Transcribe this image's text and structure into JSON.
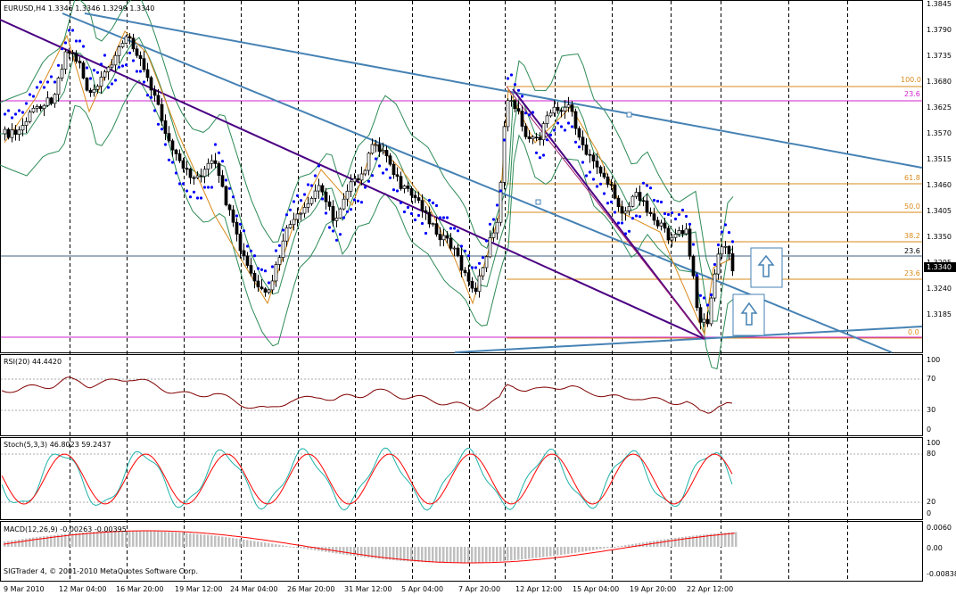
{
  "main_pane": {
    "header": "EURUSD,H4  1.3346 1.3346 1.3299 1.3340",
    "price_labels": [
      "1.3845",
      "1.3790",
      "1.3735",
      "1.3680",
      "1.3625",
      "1.3570",
      "1.3515",
      "1.3460",
      "1.3405",
      "1.3350",
      "1.3295",
      "1.3240",
      "1.3185"
    ],
    "current_price": "1.3340",
    "fib_levels": [
      {
        "label": "100.0",
        "color": "#d98a1a"
      },
      {
        "label": "23.6",
        "color": "#d020d0"
      },
      {
        "label": "61.8",
        "color": "#d98a1a"
      },
      {
        "label": "50.0",
        "color": "#d98a1a"
      },
      {
        "label": "38.2",
        "color": "#d98a1a"
      },
      {
        "label": "23.6",
        "color": "#000000"
      },
      {
        "label": "23.6",
        "color": "#d98a1a"
      },
      {
        "label": "0.0",
        "color": "#d98a1a"
      }
    ]
  },
  "rsi_pane": {
    "header": "RSI(20) 44.4420",
    "scale": [
      "100",
      "70",
      "30",
      "0"
    ]
  },
  "stoch_pane": {
    "header": "Stoch(5,3,3) 46.8023 59.2437",
    "scale": [
      "100",
      "80",
      "20",
      "0"
    ]
  },
  "macd_pane": {
    "header": "MACD(12,26,9) -0.00263 -0.00395",
    "scale": [
      "0.0060",
      "0.00",
      "-0.00838"
    ]
  },
  "copyright": "SIGTrader 4, © 2001-2010 MetaQuotes Software Corp.",
  "time_axis": [
    "9 Mar 2010",
    "12 Mar 04:00",
    "16 Mar 20:00",
    "19 Mar 12:00",
    "24 Mar 04:00",
    "26 Mar 20:00",
    "31 Mar 12:00",
    "5 Apr 04:00",
    "7 Apr 20:00",
    "12 Apr 12:00",
    "15 Apr 04:00",
    "19 Apr 20:00",
    "22 Apr 12:00"
  ],
  "colors": {
    "bull_candle": "#ffffff",
    "bear_candle": "#000000",
    "parabolic_sar": "#0000ff",
    "bollinger": "#2e8b57",
    "trendline_blue": "#4682b4",
    "trendline_purple": "#4b0082",
    "rsi_line": "#800000",
    "stoch_main": "#20b2aa",
    "stoch_signal": "#ff0000",
    "macd_hist": "#c0c0c0",
    "macd_signal": "#ff0000",
    "fib_line": "#d98a1a",
    "magenta_line": "#d020d0"
  },
  "icons": [
    "up-arrow-box-icon",
    "up-arrow-box-icon"
  ]
}
